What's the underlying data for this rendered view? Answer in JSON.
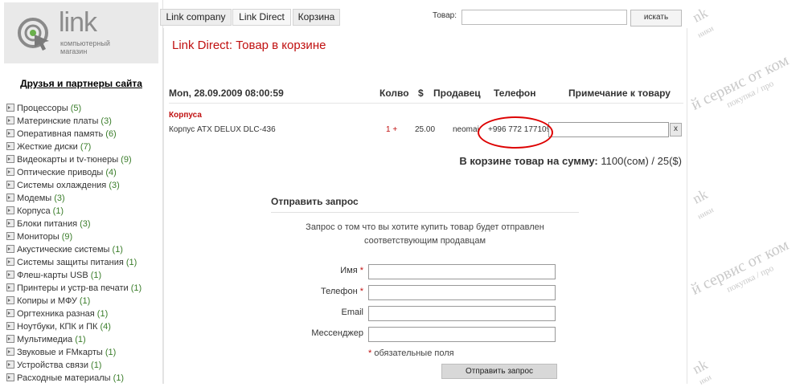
{
  "logo": {
    "word": "link",
    "subtitle": [
      "компьютерный",
      "магазин"
    ]
  },
  "tabs": [
    {
      "label": "Link company"
    },
    {
      "label": "Link Direct"
    },
    {
      "label": "Корзина"
    }
  ],
  "search": {
    "label": "Товар:",
    "value": "",
    "button": "искать"
  },
  "sidebar": {
    "title": "Друзья и партнеры сайта",
    "items": [
      {
        "label": "Процессоры",
        "count": "(5)"
      },
      {
        "label": "Материнские платы",
        "count": "(3)"
      },
      {
        "label": "Оперативная память",
        "count": "(6)"
      },
      {
        "label": "Жесткие диски",
        "count": "(7)"
      },
      {
        "label": "Видеокарты и tv-тюнеры",
        "count": "(9)"
      },
      {
        "label": "Оптические приводы",
        "count": "(4)"
      },
      {
        "label": "Системы охлаждения",
        "count": "(3)"
      },
      {
        "label": "Модемы",
        "count": "(3)"
      },
      {
        "label": "Корпуса",
        "count": "(1)"
      },
      {
        "label": "Блоки питания",
        "count": "(3)"
      },
      {
        "label": "Мониторы",
        "count": "(9)"
      },
      {
        "label": "Акустические системы",
        "count": "(1)"
      },
      {
        "label": "Системы защиты питания",
        "count": "(1)"
      },
      {
        "label": "Флеш-карты USB",
        "count": "(1)"
      },
      {
        "label": "Принтеры и устр-ва печати",
        "count": "(1)"
      },
      {
        "label": "Копиры и МФУ",
        "count": "(1)"
      },
      {
        "label": "Оргтехника разная",
        "count": "(1)"
      },
      {
        "label": "Ноутбуки, КПК и ПК",
        "count": "(4)"
      },
      {
        "label": "Мультимедиа",
        "count": "(1)"
      },
      {
        "label": "Звуковые и FMкарты",
        "count": "(1)"
      },
      {
        "label": "Устройства связи",
        "count": "(1)"
      },
      {
        "label": "Расходные материалы",
        "count": "(1)"
      }
    ]
  },
  "cart": {
    "title": "Link Direct: Товар в корзине",
    "date": "Mon, 28.09.2009 08:00:59",
    "columns": {
      "qty": "Колво",
      "price": "$",
      "seller": "Продавец",
      "phone": "Телефон",
      "note": "Примечание к товару"
    },
    "category": "Корпуса",
    "item": {
      "name": "Корпус ATX DELUX DLC-436",
      "qty": "1",
      "qty_plus": "+",
      "price": "25.00",
      "seller": "neomai",
      "phone": "+996 772 177109",
      "note": "",
      "remove": "x"
    },
    "total_label": "В корзине товар на сумму:",
    "total_value": "1100(сом) / 25($)"
  },
  "request": {
    "title": "Отправить запрос",
    "description": [
      "Запрос о том что вы хотите купить товар будет отправлен",
      "соответствующим продавцам"
    ],
    "fields": {
      "name": {
        "label": "Имя",
        "required": "*",
        "value": ""
      },
      "phone": {
        "label": "Телефон",
        "required": "*",
        "value": ""
      },
      "email": {
        "label": "Email",
        "value": ""
      },
      "messenger": {
        "label": "Мессенджер",
        "value": ""
      }
    },
    "required_star": "*",
    "required_note": "обязательные поля",
    "submit": "Отправить запрос"
  },
  "watermark": {
    "top_main": "nk",
    "top_sub": "ники",
    "diag1_main": "й сервис от ком",
    "diag1_sub": "покупка / про",
    "mid_main": "nk",
    "mid_sub": "ники",
    "diag2_main": "й сервис от ком",
    "diag2_sub": "покупка / про",
    "bot_main": "nk",
    "bot_sub": "ики"
  }
}
